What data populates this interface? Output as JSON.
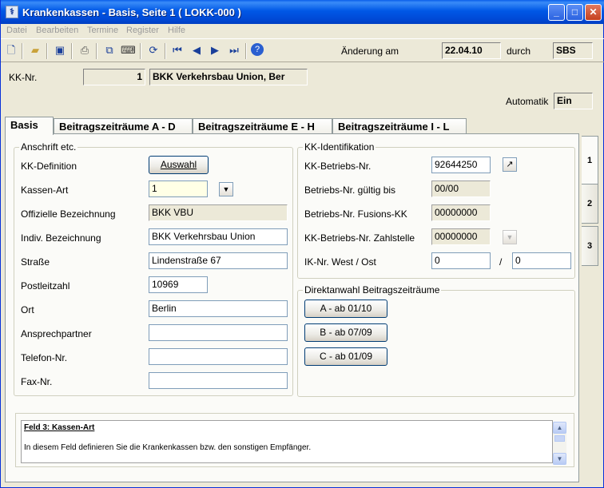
{
  "window": {
    "title": "Krankenkassen - Basis, Seite 1   ( LOKK-000 )"
  },
  "menu": [
    "Datei",
    "Bearbeiten",
    "Termine",
    "Register",
    "Hilfe"
  ],
  "header": {
    "aenderung_label": "Änderung am",
    "aenderung_value": "22.04.10",
    "durch_label": "durch",
    "durch_value": "SBS",
    "kknr_label": "KK-Nr.",
    "kknr_value": "1",
    "kk_name": "BKK Verkehrsbau Union, Ber",
    "automatik_label": "Automatik",
    "automatik_value": "Ein"
  },
  "tabs": [
    "Basis",
    "Beitragszeiträume A - D",
    "Beitragszeiträume E - H",
    "Beitragszeiträume I - L"
  ],
  "side_tabs": [
    "1",
    "2",
    "3"
  ],
  "anschrift": {
    "title": "Anschrift etc.",
    "kk_def_label": "KK-Definition",
    "auswahl_button": "Auswahl",
    "kassen_art_label": "Kassen-Art",
    "kassen_art_value": "1",
    "offiz_label": "Offizielle Bezeichnung",
    "offiz_value": "BKK VBU",
    "indiv_label": "Indiv. Bezeichnung",
    "indiv_value": "BKK Verkehrsbau Union",
    "strasse_label": "Straße",
    "strasse_value": "Lindenstraße 67",
    "plz_label": "Postleitzahl",
    "plz_value": "10969",
    "ort_label": "Ort",
    "ort_value": "Berlin",
    "ansprech_label": "Ansprechpartner",
    "ansprech_value": "",
    "telefon_label": "Telefon-Nr.",
    "telefon_value": "",
    "fax_label": "Fax-Nr.",
    "fax_value": ""
  },
  "kk_ident": {
    "title": "KK-Identifikation",
    "betriebs_label": "KK-Betriebs-Nr.",
    "betriebs_value": "92644250",
    "gueltig_label": "Betriebs-Nr. gültig bis",
    "gueltig_value": "00/00",
    "fusion_label": "Betriebs-Nr. Fusions-KK",
    "fusion_value": "00000000",
    "zahlstelle_label": "KK-Betriebs-Nr. Zahlstelle",
    "zahlstelle_value": "00000000",
    "iknr_label": "IK-Nr. West / Ost",
    "iknr_west": "0",
    "iknr_sep": "/",
    "iknr_ost": "0"
  },
  "direktwahl": {
    "title": "Direktanwahl Beitragszeiträume",
    "buttons": [
      "A - ab 01/10",
      "B - ab 07/09",
      "C - ab 01/09"
    ]
  },
  "help": {
    "title": "Feld 3: Kassen-Art",
    "text": "In diesem Feld definieren Sie die Krankenkassen bzw. den sonstigen Empfänger."
  }
}
